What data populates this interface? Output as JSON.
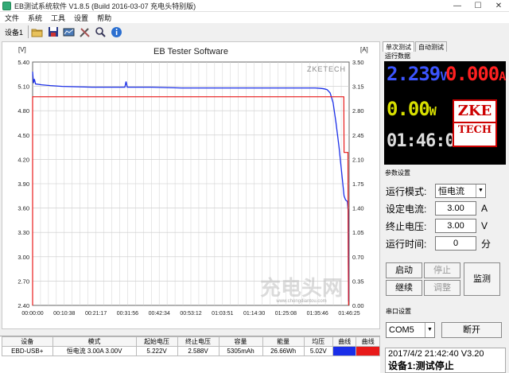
{
  "window": {
    "title": "EB测试系统软件 V1.8.5 (Build 2016-03-07 充电头特别版)",
    "controls": [
      "—",
      "☐",
      "✕"
    ]
  },
  "menu": [
    "文件",
    "系统",
    "工具",
    "设置",
    "帮助"
  ],
  "toolbar": {
    "device_label": "设备1"
  },
  "chart_data": {
    "type": "line",
    "title": "EB Tester Software",
    "watermark": "ZKETECH",
    "ylabel_left": "[V]",
    "ylabel_right": "[A]",
    "ylim_left": [
      2.4,
      5.4
    ],
    "ylim_right": [
      0.0,
      3.5
    ],
    "yticks_left": [
      "5.40",
      "5.10",
      "4.80",
      "4.50",
      "4.20",
      "3.90",
      "3.60",
      "3.30",
      "3.00",
      "2.70",
      "2.40"
    ],
    "yticks_right": [
      "3.50",
      "3.15",
      "2.80",
      "2.45",
      "2.10",
      "1.75",
      "1.40",
      "1.05",
      "0.70",
      "0.35",
      "0.00"
    ],
    "xticks": [
      "00:00:00",
      "00:10:38",
      "00:21:17",
      "00:31:56",
      "00:42:34",
      "00:53:12",
      "01:03:51",
      "01:14:30",
      "01:25:08",
      "01:35:46",
      "01:46:25"
    ],
    "x_minutes_max": 106.4,
    "series": [
      {
        "axis": "left",
        "color": "#1a2ee8",
        "x": [
          0,
          0.3,
          0.6,
          1,
          3,
          6,
          10,
          20,
          31,
          31.4,
          31.8,
          40,
          50,
          60,
          70,
          80,
          90,
          95,
          97,
          98,
          99,
          100,
          101,
          102,
          103,
          104,
          104.7,
          105.2,
          105.8,
          106.1,
          106.2
        ],
        "y": [
          5.28,
          5.14,
          5.19,
          5.13,
          5.12,
          5.11,
          5.1,
          5.09,
          5.09,
          5.16,
          5.09,
          5.09,
          5.08,
          5.08,
          5.08,
          5.08,
          5.08,
          5.08,
          5.075,
          5.07,
          5.06,
          5.02,
          4.9,
          4.65,
          4.35,
          4.0,
          3.75,
          3.7,
          3.68,
          3.55,
          2.45
        ]
      },
      {
        "axis": "right",
        "color": "#e81a1a",
        "x": [
          0,
          0,
          104.6,
          104.7,
          106.0,
          106.1,
          106.2
        ],
        "y": [
          0.0,
          3.0,
          3.0,
          2.2,
          2.2,
          0.6,
          0.0
        ]
      }
    ]
  },
  "watermark_site": {
    "text": "充电头网",
    "url": "www.chongdiantou.com"
  },
  "table": {
    "headers": [
      "设备",
      "模式",
      "起始电压",
      "终止电压",
      "容量",
      "能量",
      "均压",
      "曲线",
      "曲线"
    ],
    "row": [
      "EBD-USB+",
      "恒电流 3.00A 3.00V",
      "5.222V",
      "2.588V",
      "5305mAh",
      "26.66Wh",
      "5.02V",
      "",
      ""
    ]
  },
  "right": {
    "tabs": [
      "单次测试",
      "自动测试"
    ],
    "run_data_label": "运行数据",
    "voltage": "2.239",
    "voltage_unit": "V",
    "current": "0.000",
    "current_unit": "A",
    "power": "0.00",
    "power_unit": "W",
    "time": "01:46:07",
    "logo_top": "ZKE",
    "logo_bottom": "TECH",
    "params_label": "参数设置",
    "mode_label": "运行模式:",
    "mode_value": "恒电流",
    "current_set_label": "设定电流:",
    "current_set_value": "3.00",
    "current_set_unit": "A",
    "cutoff_label": "终止电压:",
    "cutoff_value": "3.00",
    "cutoff_unit": "V",
    "runtime_label": "运行时间:",
    "runtime_value": "0",
    "runtime_unit": "分",
    "btn_start": "启动",
    "btn_stop": "停止",
    "btn_continue": "继续",
    "btn_adjust": "调整",
    "btn_monitor": "监测",
    "serial_label": "串口设置",
    "port_value": "COM5",
    "btn_disconnect": "断开",
    "status_time": "2017/4/2 21:42:40  V3.20",
    "status_msg": "设备1:测试停止"
  }
}
